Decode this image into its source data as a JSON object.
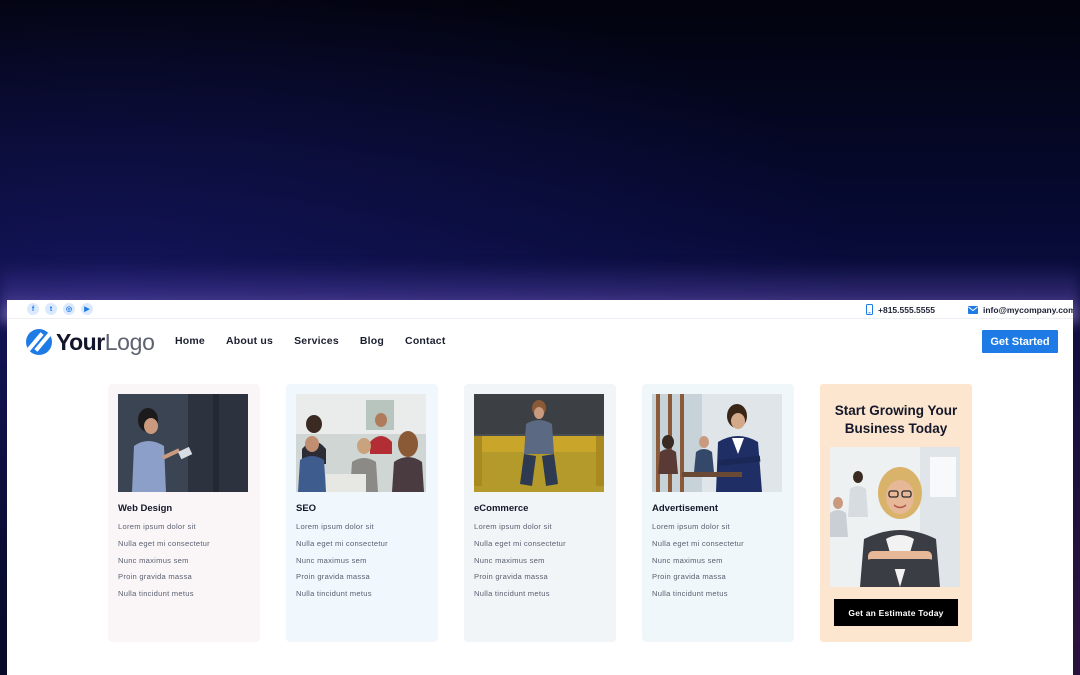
{
  "topbar": {
    "social": [
      {
        "icon": "facebook-icon",
        "glyph": "f"
      },
      {
        "icon": "twitter-icon",
        "glyph": "t"
      },
      {
        "icon": "instagram-icon",
        "glyph": "◎"
      },
      {
        "icon": "youtube-icon",
        "glyph": "▶"
      }
    ],
    "phone": "+815.555.5555",
    "email": "info@mycompany.com"
  },
  "header": {
    "logo_bold": "Your",
    "logo_light": "Logo",
    "nav": [
      "Home",
      "About us",
      "Services",
      "Blog",
      "Contact"
    ],
    "cta": "Get Started"
  },
  "services": [
    {
      "title": "Web Design",
      "items": [
        "Lorem ipsum dolor sit",
        "Nulla eget mi consectetur",
        "Nunc maximus sem",
        "Proin gravida massa",
        "Nulla tincidunt metus"
      ]
    },
    {
      "title": "SEO",
      "items": [
        "Lorem ipsum dolor sit",
        "Nulla eget mi consectetur",
        "Nunc maximus sem",
        "Proin gravida massa",
        "Nulla tincidunt metus"
      ]
    },
    {
      "title": "eCommerce",
      "items": [
        "Lorem ipsum dolor sit",
        "Nulla eget mi consectetur",
        "Nunc maximus sem",
        "Proin gravida massa",
        "Nulla tincidunt metus"
      ]
    },
    {
      "title": "Advertisement",
      "items": [
        "Lorem ipsum dolor sit",
        "Nulla eget mi consectetur",
        "Nunc maximus sem",
        "Proin gravida massa",
        "Nulla tincidunt metus"
      ]
    }
  ],
  "promo": {
    "title": "Start Growing Your\nBusiness Today",
    "button": "Get an Estimate Today"
  },
  "colors": {
    "accent": "#1e7be6",
    "promo_bg": "#fde6cf"
  }
}
